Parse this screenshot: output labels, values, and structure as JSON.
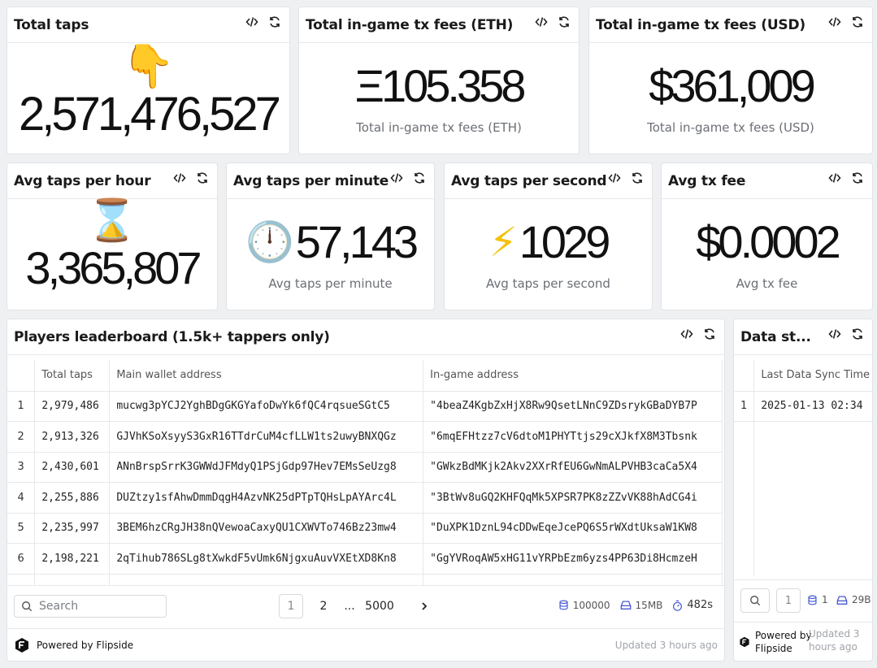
{
  "cards": {
    "total_taps": {
      "title": "Total taps",
      "emoji": "👇",
      "value": "2,571,476,527"
    },
    "fees_eth": {
      "title": "Total in-game tx fees (ETH)",
      "value": "Ξ105.358",
      "subtitle": "Total in-game tx fees (ETH)"
    },
    "fees_usd": {
      "title": "Total in-game tx fees (USD)",
      "value": "$361,009",
      "subtitle": "Total in-game tx fees (USD)"
    },
    "avg_hour": {
      "title": "Avg taps per hour",
      "emoji": "⌛",
      "value": "3,365,807"
    },
    "avg_minute": {
      "title": "Avg taps per minute",
      "emoji": "🕛",
      "value": "57,143",
      "subtitle": "Avg taps per minute"
    },
    "avg_second": {
      "title": "Avg taps per second",
      "emoji": "⚡",
      "value": "1029",
      "subtitle": "Avg taps per second"
    },
    "avg_fee": {
      "title": "Avg tx fee",
      "value": "$0.0002",
      "subtitle": "Avg tx fee"
    }
  },
  "leaderboard": {
    "title": "Players leaderboard (1.5k+ tappers only)",
    "columns": [
      "Total taps",
      "Main wallet address",
      "In-game address"
    ],
    "rows": [
      {
        "n": "1",
        "taps": "2,979,486",
        "wallet": "mucwg3pYCJ2YghBDgGKGYafoDwYk6fQC4rqsueSGtC5",
        "ingame": "\"4beaZ4KgbZxHjX8Rw9QsetLNnC9ZDsrykGBaDYB7P"
      },
      {
        "n": "2",
        "taps": "2,913,326",
        "wallet": "GJVhKSoXsyyS3GxR16TTdrCuM4cfLLW1ts2uwyBNXQGz",
        "ingame": "\"6mqEFHtzz7cV6dtoM1PHYTtjs29cXJkfX8M3Tbsnk"
      },
      {
        "n": "3",
        "taps": "2,430,601",
        "wallet": "ANnBrspSrrK3GWWdJFMdyQ1PSjGdp97Hev7EMsSeUzg8",
        "ingame": "\"GWkzBdMKjk2Akv2XXrRfEU6GwNmALPVHB3caCa5X4"
      },
      {
        "n": "4",
        "taps": "2,255,886",
        "wallet": "DUZtzy1sfAhwDmmDqgH4AzvNK25dPTpTQHsLpAYArc4L",
        "ingame": "\"3BtWv8uGQ2KHFQqMk5XPSR7PK8zZZvVK88hAdCG4i"
      },
      {
        "n": "5",
        "taps": "2,235,997",
        "wallet": "3BEM6hzCRgJH38nQVewoaCaxyQU1CXWVTo746Bz23mw4",
        "ingame": "\"DuXPK1DznL94cDDwEqeJcePQ6S5rWXdtUksaW1KW8"
      },
      {
        "n": "6",
        "taps": "2,198,221",
        "wallet": "2qTihub786SLg8tXwkdF5vUmk6NjgxuAuvVXEtXD8Kn8",
        "ingame": "\"GgYVRoqAW5xHG11vYRPbEzm6yzs4PP63Di8HcmzeH"
      }
    ],
    "search_placeholder": "Search",
    "pages": [
      "1",
      "2",
      "...",
      "5000"
    ],
    "stats": {
      "rows": "100000",
      "size": "15MB",
      "time": "482s"
    },
    "powered_by": "Powered by Flipside",
    "updated": "Updated 3 hours ago"
  },
  "sync": {
    "title": "Data st...",
    "column": "Last Data Sync Time (",
    "row": {
      "n": "1",
      "value": "2025-01-13 02:34"
    },
    "page": "1",
    "stats": {
      "rows": "1",
      "size": "29B"
    },
    "powered_line1": "Powered by",
    "powered_line2": "Flipside",
    "updated_line1": "Updated 3",
    "updated_line2": "hours ago"
  },
  "colors": {
    "accent": "#4a5bd4",
    "border": "#e1e3e6",
    "background": "#eef0f2",
    "bolt": "#f4c20d"
  },
  "icons": {
    "code": "code-icon",
    "refresh": "refresh-icon",
    "search": "search-icon",
    "database": "database-icon",
    "storage": "storage-icon",
    "timer": "timer-icon",
    "logo": "flipside-logo-icon"
  }
}
